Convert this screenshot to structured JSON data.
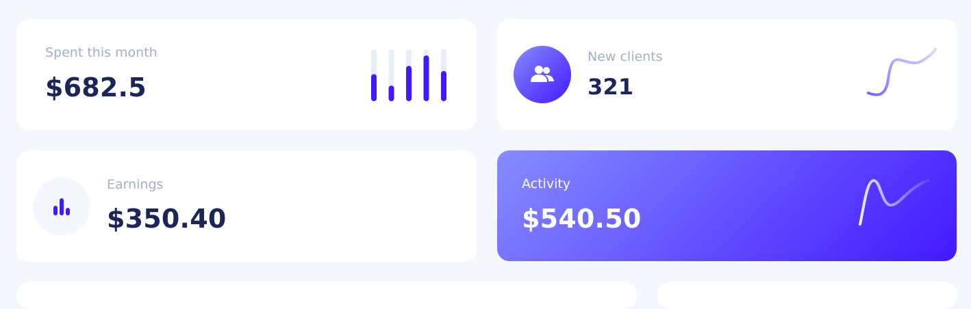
{
  "spent": {
    "label": "Spent this month",
    "value": "$682.5",
    "bar_levels": [
      0.52,
      0.3,
      0.68,
      0.88,
      0.58
    ]
  },
  "clients": {
    "label": "New clients",
    "value": "321",
    "icon": "users-icon"
  },
  "earnings": {
    "label": "Earnings",
    "value": "$350.40",
    "icon": "bar-chart-icon"
  },
  "activity": {
    "label": "Activity",
    "value": "$540.50"
  },
  "colors": {
    "accent": "#4318FF",
    "accent_light": "#868CFF",
    "track": "#E9EDF7",
    "text_dark": "#1B2559",
    "text_muted": "#A3AED0",
    "background": "#F4F7FE"
  }
}
